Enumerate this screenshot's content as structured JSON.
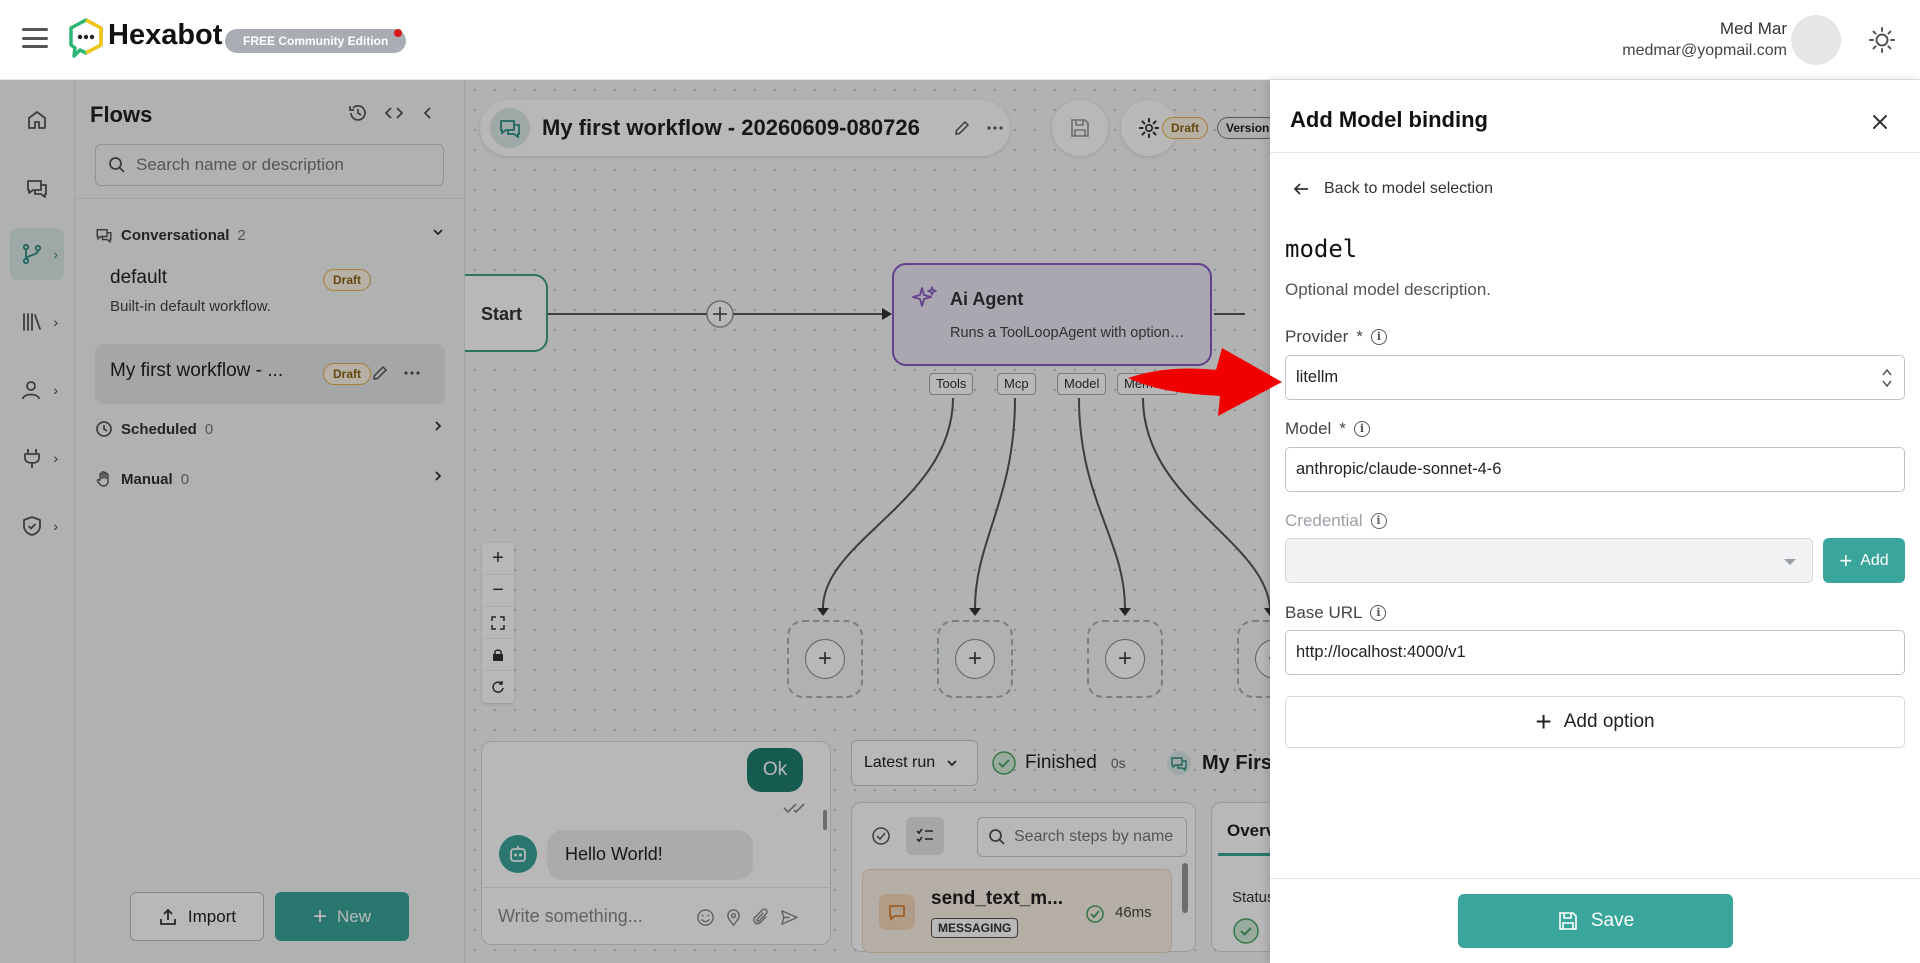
{
  "app": {
    "brand": "Hexabot",
    "edition": "FREE Community Edition",
    "user_name": "Med Mar",
    "user_email": "medmar@yopmail.com"
  },
  "nav_icons": [
    "home-icon",
    "chat-icon",
    "flows-icon",
    "library-icon",
    "users-icon",
    "plug-icon",
    "shield-icon"
  ],
  "flows_panel": {
    "title": "Flows",
    "search_placeholder": "Search name or description",
    "categories": [
      {
        "name": "Conversational",
        "count": "2"
      },
      {
        "name": "Scheduled",
        "count": "0"
      },
      {
        "name": "Manual",
        "count": "0"
      }
    ],
    "items": [
      {
        "name": "default",
        "badge": "Draft",
        "description": "Built-in default workflow."
      },
      {
        "name": "My first workflow - ...",
        "badge": "Draft"
      }
    ],
    "import_label": "Import",
    "new_label": "New"
  },
  "canvas": {
    "workflow_title": "My first workflow - 20260609-080726",
    "draft_pill": "Draft",
    "version_pill": "Version",
    "start_node_label": "Start",
    "agent_node": {
      "title": "Ai Agent",
      "description": "Runs a ToolLoopAgent with optional tools"
    },
    "ports": [
      "Tools",
      "Mcp",
      "Model",
      "Memory"
    ]
  },
  "chat": {
    "user_message": "Ok",
    "bot_message": "Hello World!",
    "input_placeholder": "Write something..."
  },
  "runs": {
    "run_select": "Latest run",
    "status": "Finished",
    "duration": "0s",
    "flow_name": "My First",
    "step_search_placeholder": "Search steps by name",
    "step": {
      "name": "send_text_m...",
      "tag": "MESSAGING",
      "time": "46ms"
    },
    "overview_tab": "Overv",
    "status_label": "Status"
  },
  "drawer": {
    "title": "Add Model binding",
    "back_label": "Back to model selection",
    "binding_name": "model",
    "binding_description": "Optional model description.",
    "provider_label": "Provider",
    "provider_value": "litellm",
    "model_label": "Model",
    "model_value": "anthropic/claude-sonnet-4-6",
    "credential_label": "Credential",
    "credential_value": "",
    "add_credential_label": "Add",
    "base_url_label": "Base URL",
    "base_url_value": "http://localhost:4000/v1",
    "add_option_label": "Add option",
    "save_label": "Save",
    "required_marker": "*",
    "info_glyph": "i"
  },
  "colors": {
    "accent": "#3aa59a",
    "agent_border": "#8b5cc6",
    "start_border": "#3fa27c",
    "annotation_arrow": "#f20000",
    "draft_badge": "#e3b04a"
  }
}
